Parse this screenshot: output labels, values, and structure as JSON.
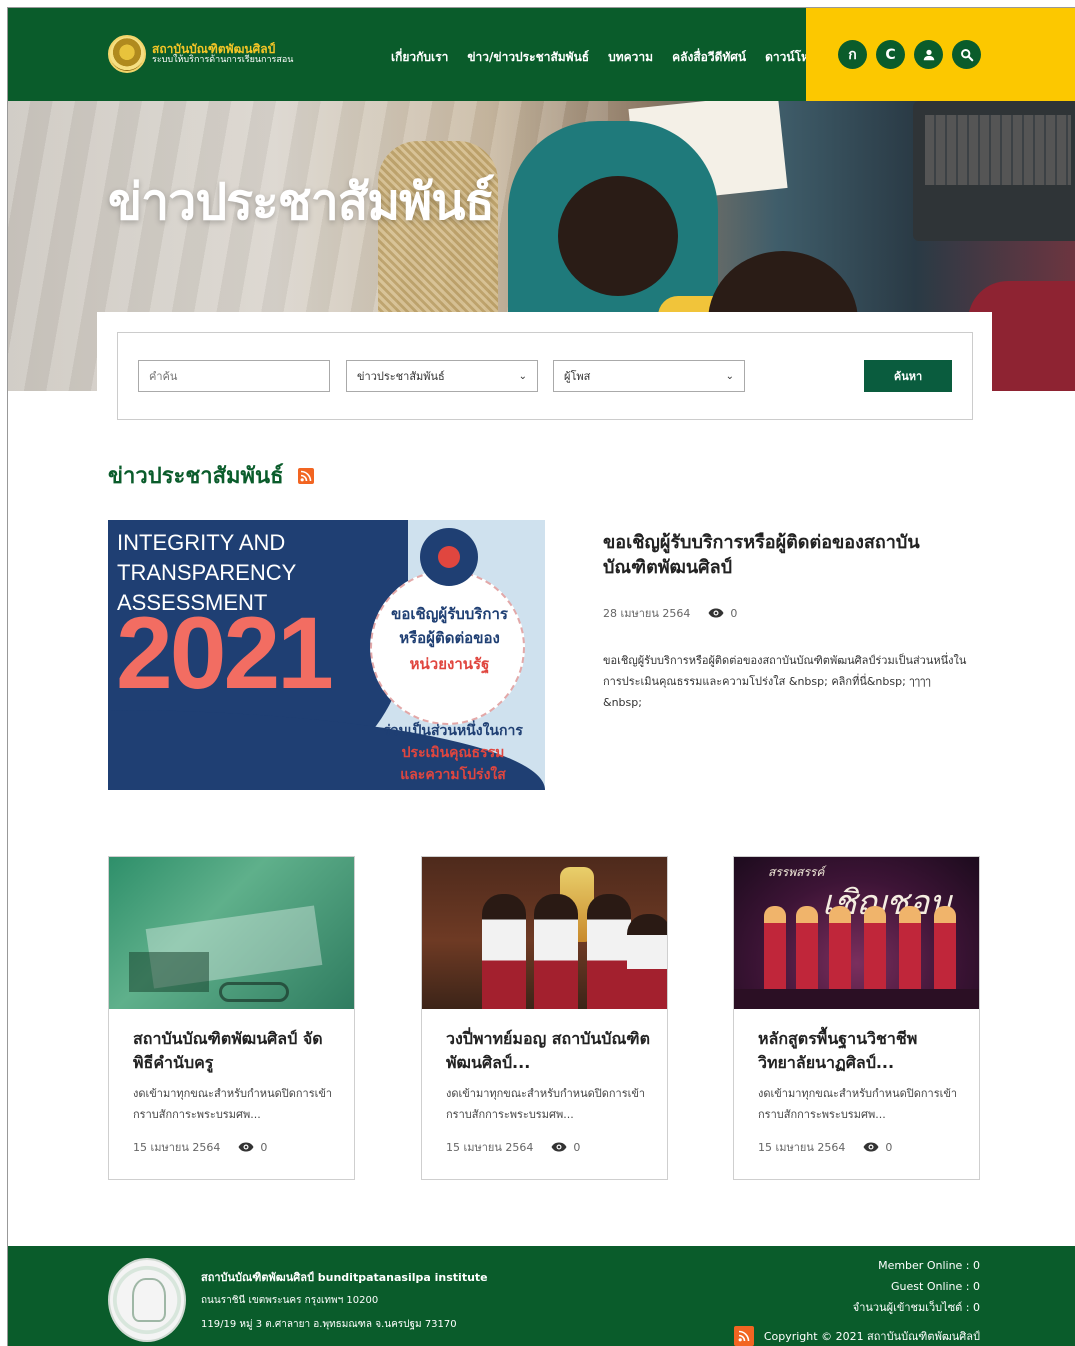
{
  "header": {
    "logo_title": "สถาบันบัณฑิตพัฒนศิลป์",
    "logo_subtitle": "ระบบให้บริการด้านการเรียนการสอน",
    "nav": [
      "เกี่ยวกับเรา",
      "ข่าว/ข่าวประชาสัมพันธ์",
      "บทความ",
      "คลังสื่อวีดีทัศน์",
      "ดาวน์โหลด"
    ],
    "icon_buttons": [
      {
        "label": "ก",
        "icon": "font-size-thai-icon"
      },
      {
        "label": "C",
        "icon": "contrast-icon"
      },
      {
        "label": "",
        "icon": "user-icon"
      },
      {
        "label": "",
        "icon": "search-icon"
      }
    ]
  },
  "hero": {
    "title": "ข่าวประชาสัมพันธ์"
  },
  "search": {
    "keyword_placeholder": "คำค้น",
    "category_selected": "ข่าวประชาสัมพันธ์",
    "author_selected": "ผู้โพส",
    "button_label": "ค้นหา"
  },
  "section": {
    "title": "ข่าวประชาสัมพันธ์"
  },
  "featured": {
    "image_text": {
      "line1": "INTEGRITY AND",
      "line2": "TRANSPARENCY",
      "line3": "ASSESSMENT",
      "year": "2021",
      "circle_line1": "ขอเชิญผู้รับบริการ",
      "circle_line2": "หรือผู้ติดต่อของ",
      "circle_line3": "หน่วยงานรัฐ",
      "bottom_line1": "ร่วมเป็นส่วนหนึ่งในการ",
      "bottom_line2": "ประเมินคุณธรรม",
      "bottom_line3": "และความโปร่งใส"
    },
    "title": "ขอเชิญผู้รับบริการหรือผู้ติดต่อของสถาบันบัณฑิตพัฒนศิลป์",
    "date": "28 เมษายน 2564",
    "views": "0",
    "description": "ขอเชิญผู้รับบริการหรือผู้ติดต่อของสถาบันบัณฑิตพัฒนศิลป์ร่วมเป็นส่วนหนึ่งในการประเมินคุณธรรมและความโปร่งใส &nbsp; คลิกที่นี่&nbsp; ๅๅๅๅ &nbsp;"
  },
  "cards": [
    {
      "title": "สถาบันบัณฑิตพัฒนศิลป์ จัดพิธีคำนับครู",
      "description": "งดเข้ามาทุกขณะสำหรับกำหนดปิดการเข้ากราบสักการะพระบรมศพ...",
      "date": "15 เมษายน 2564",
      "views": "0"
    },
    {
      "title": "วงปี่พาทย์มอญ สถาบันบัณฑิตพัฒนศิลป์...",
      "description": "งดเข้ามาทุกขณะสำหรับกำหนดปิดการเข้ากราบสักการะพระบรมศพ...",
      "date": "15 เมษายน 2564",
      "views": "0"
    },
    {
      "title": "หลักสูตรพื้นฐานวิชาชีพวิทยาลัยนาฏศิลป์...",
      "description": "งดเข้ามาทุกขณะสำหรับกำหนดปิดการเข้ากราบสักการะพระบรมศพ...",
      "date": "15 เมษายน 2564",
      "views": "0",
      "image_text_small": "สรรพสรรค์",
      "image_text_big": "เชิญชอบ"
    }
  ],
  "footer": {
    "org_name": "สถาบันบัณฑิตพัฒนศิลป์ bunditpatanasilpa institute",
    "address1": "ถนนราชินี เขตพระนคร กรุงเทพฯ 10200",
    "address2": "119/19 หมู่ 3 ต.ศาลายา อ.พุทธมณฑล จ.นครปฐม 73170",
    "member_online": "Member Online : 0",
    "guest_online": "Guest Online : 0",
    "visitors": "จำนวนผู้เข้าชมเว็บไซต์ : 0",
    "copyright": "Copyright © 2021 สถาบันบัณฑิตพัฒนศิลป์"
  },
  "colors": {
    "primary_green": "#0a5c2b",
    "accent_yellow": "#fcc800",
    "button_green": "#0a5c3e",
    "rss_orange": "#f26522"
  }
}
